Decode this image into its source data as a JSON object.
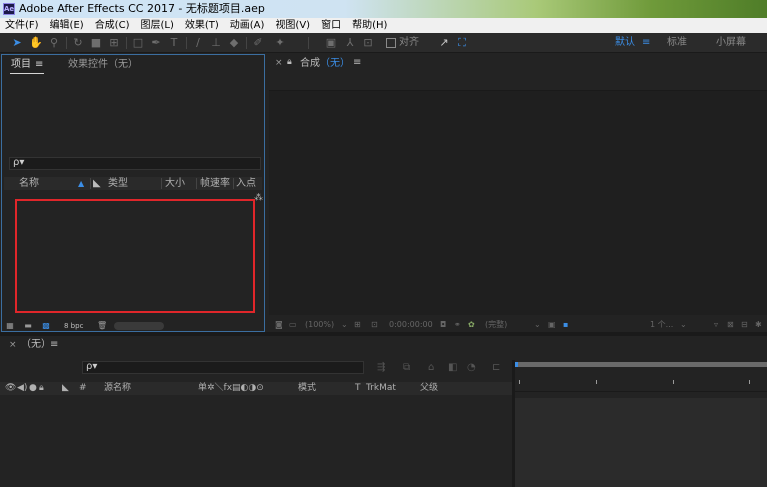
{
  "window": {
    "app_icon_text": "Ae",
    "title": "Adobe After Effects CC 2017 - 无标题项目.aep"
  },
  "menu": [
    "文件(F)",
    "编辑(E)",
    "合成(C)",
    "图层(L)",
    "效果(T)",
    "动画(A)",
    "视图(V)",
    "窗口",
    "帮助(H)"
  ],
  "toolbar": {
    "align_label": "对齐",
    "workspaces": [
      "默认",
      "≡",
      "标准",
      "小屏幕"
    ]
  },
  "project_panel": {
    "tab_project": "项目",
    "tab_menu": "≡",
    "tab_effects": "效果控件（无）",
    "search_icon": "ρ▾",
    "columns": {
      "name": "名称",
      "type": "类型",
      "size": "大小",
      "framerate": "帧速率",
      "inpoint": "入点"
    },
    "bpc": "8 bpc"
  },
  "comp_panel": {
    "close": "×",
    "title_prefix": "合成",
    "title_value": "（无）",
    "menu": "≡",
    "footer": {
      "zoom": "(100%)",
      "time": "0:00:00:00",
      "quality": "(完整)",
      "views": "1 个..."
    }
  },
  "timeline": {
    "close": "×",
    "title": "（无）",
    "menu": "≡",
    "search_icon": "ρ▾",
    "columns": {
      "hash": "#",
      "source_name": "源名称",
      "switches": "单✲＼fx▤◐◑⊙",
      "mode": "模式",
      "t": "T",
      "trkmat": "TrkMat",
      "parent": "父级"
    }
  }
}
